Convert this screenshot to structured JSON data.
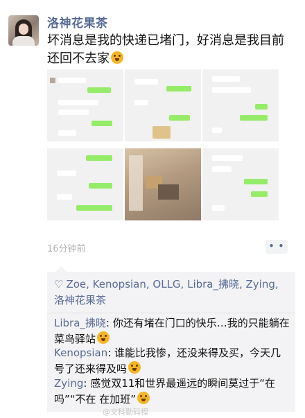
{
  "post": {
    "author": "洛神花果茶",
    "text": "坏消息是我的快递已堵门，好消息是我目前还回不去家",
    "time": "16分钟前",
    "more_label": "• •",
    "likes": "Zoe, Kenopsian, OLLG, Libra_拂晓, Zying, 洛神花果茶",
    "comments": [
      {
        "name": "Libra_拂晓",
        "text": "你还有堵在门口的快乐…我的只能躺在菜鸟驿站"
      },
      {
        "name": "Kenopsian",
        "text": "谁能比我惨，还没来得及买，今天几号了还来得及吗"
      },
      {
        "name": "Zying",
        "text": "感觉双11和世界最遥远的瞬间莫过于“在吗”“不在 在加班”"
      }
    ],
    "watermark": "@文科勤码程"
  },
  "icons": {
    "avatar": "avatar-photo",
    "emoji": "face-emoji-icon",
    "heart": "heart-outline-icon",
    "more": "ellipsis-icon"
  },
  "colors": {
    "name_blue": "#576b95",
    "bubble_green": "#95ec69",
    "comment_bg": "#f3f3f5",
    "time_gray": "#b2b2b2"
  }
}
